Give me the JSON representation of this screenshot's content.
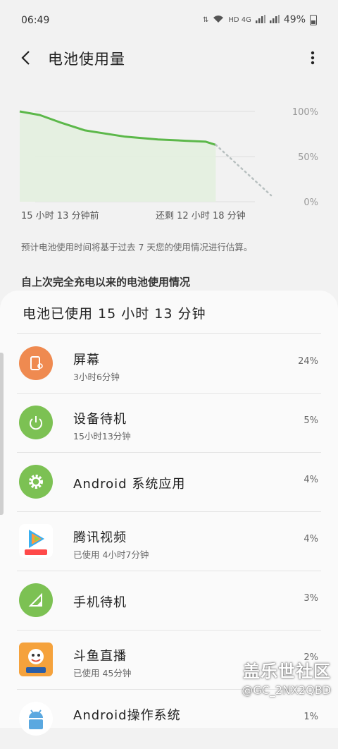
{
  "status": {
    "time": "06:49",
    "network": "HD 4G",
    "battery": "49%"
  },
  "header": {
    "title": "电池使用量"
  },
  "chart_data": {
    "type": "line",
    "x_labels": [
      "15 小时 13 分钟前",
      "还剩 12 小时 18 分钟"
    ],
    "y_ticks": [
      "100%",
      "50%",
      "0%"
    ],
    "ylim": [
      0,
      100
    ],
    "series": [
      {
        "values": [
          [
            0,
            100
          ],
          [
            0.08,
            96
          ],
          [
            0.16,
            88
          ],
          [
            0.26,
            79
          ],
          [
            0.42,
            72
          ],
          [
            0.55,
            69
          ],
          [
            0.66,
            67.5
          ],
          [
            0.74,
            66.5
          ],
          [
            0.78,
            63
          ]
        ]
      },
      {
        "values": [
          [
            0.78,
            63
          ],
          [
            1.0,
            7
          ]
        ]
      }
    ],
    "colors": {
      "line": "#5cb84a",
      "fill": "#e3f0df",
      "projection": "#b8c0c0",
      "grid": "#dddddd"
    }
  },
  "note": "预计电池使用时间将基于过去 7 天您的使用情况进行估算。",
  "section_title": "自上次完全充电以来的电池使用情况",
  "sheet": {
    "title": "电池已使用 15 小时 13 分钟",
    "items": [
      {
        "name": "屏幕",
        "sub": "3小时6分钟",
        "pct": "24%",
        "icon": "screen-icon",
        "color": "#ef8a50"
      },
      {
        "name": "设备待机",
        "sub": "15小时13分钟",
        "pct": "5%",
        "icon": "power-icon",
        "color": "#7cc153"
      },
      {
        "name": "Android 系统应用",
        "sub": "",
        "pct": "4%",
        "icon": "gear-icon",
        "color": "#7cc153"
      },
      {
        "name": "腾讯视频",
        "sub": "已使用 4小时7分钟",
        "pct": "4%",
        "icon": "tencent-video-icon",
        "color": "#ffffff"
      },
      {
        "name": "手机待机",
        "sub": "",
        "pct": "3%",
        "icon": "signal-icon",
        "color": "#7cc153"
      },
      {
        "name": "斗鱼直播",
        "sub": "已使用 45分钟",
        "pct": "2%",
        "icon": "douyu-icon",
        "color": "#f5a23c"
      },
      {
        "name": "Android操作系统",
        "sub": "",
        "pct": "1%",
        "icon": "android-icon",
        "color": "#ffffff"
      }
    ]
  },
  "watermark": {
    "line1": "盖乐世社区",
    "line2": "@GC_2NX2QBD"
  }
}
